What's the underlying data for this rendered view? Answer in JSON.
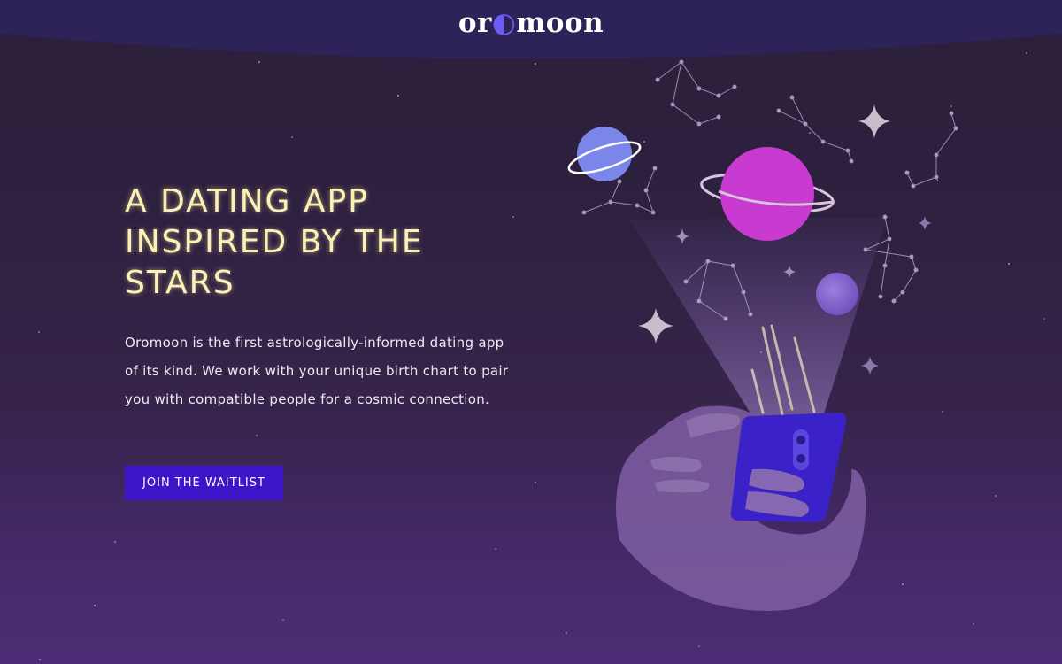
{
  "brand": {
    "logo_prefix": "or",
    "logo_moon": "◐",
    "logo_suffix": "moon"
  },
  "hero": {
    "title": "A DATING APP INSPIRED BY THE STARS",
    "description": "Oromoon is the first astrologically-informed dating app of its kind. We work with your unique birth chart to pair you with compatible people for a cosmic connection.",
    "cta_label": "JOIN THE WAITLIST"
  },
  "colors": {
    "background_top": "#2b1f3a",
    "background_bottom": "#4d2c75",
    "header": "#2d2358",
    "title": "#fbf0b6",
    "cta": "#3d16c9",
    "planet_pink": "#c93ad0",
    "planet_blue": "#7b86ea",
    "planet_purple": "#8460d0",
    "phone": "#3a22c8"
  },
  "icons": {
    "sparkle": "four-point-star-icon",
    "planet": "ringed-planet-icon"
  }
}
